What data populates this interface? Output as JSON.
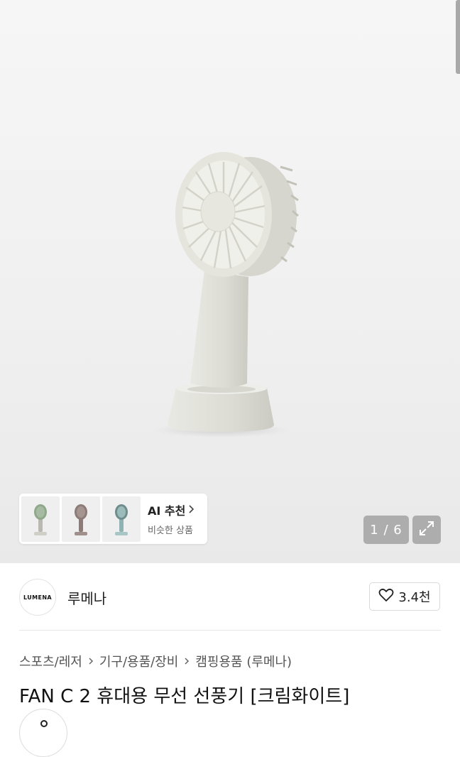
{
  "gallery": {
    "counter": "1 / 6",
    "expand_icon": "expand-icon",
    "ai_card": {
      "title": "AI 추천",
      "subtitle": "비슷한 상품",
      "thumbnails": [
        {
          "name": "green-fan",
          "color": "#8fa88a"
        },
        {
          "name": "brown-fan",
          "color": "#8c7b76"
        },
        {
          "name": "mint-fan",
          "color": "#8fb3b3"
        }
      ]
    }
  },
  "brand": {
    "logo_text": "LUMENA",
    "name": "루메나"
  },
  "like": {
    "count": "3.4천"
  },
  "breadcrumb": [
    "스포츠/레저",
    "기구/용품/장비",
    "캠핑용품 (루메나)"
  ],
  "product": {
    "title": "FAN C 2 휴대용 무선 선풍기 [크림화이트]",
    "color": "#dcdcd4"
  }
}
